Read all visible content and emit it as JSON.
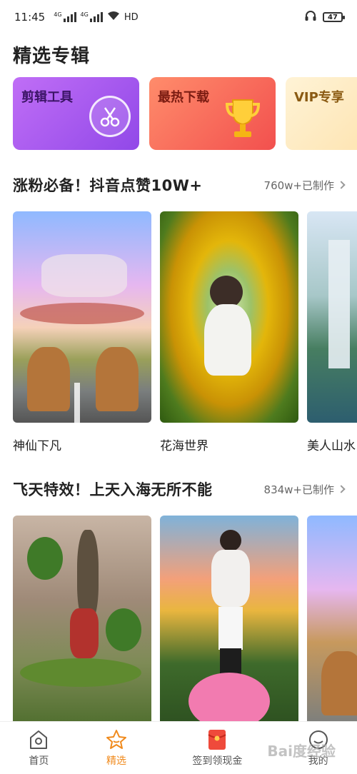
{
  "status_bar": {
    "time": "11:45",
    "network_a": "4G",
    "network_b": "4G",
    "hd": "HD",
    "battery": "47"
  },
  "page": {
    "title": "精选专辑"
  },
  "albums": [
    {
      "label": "剪辑工具",
      "icon": "scissors-icon"
    },
    {
      "label": "最热下载",
      "icon": "trophy-icon"
    },
    {
      "label": "VIP专享",
      "icon": "sparkle-icon"
    }
  ],
  "sections": [
    {
      "title": "涨粉必备！抖音点赞10W+",
      "more": "760w+已制作",
      "videos": [
        {
          "title": "神仙下凡"
        },
        {
          "title": "花海世界"
        },
        {
          "title": "美人山水"
        }
      ]
    },
    {
      "title": "飞天特效！上天入海无所不能",
      "more": "834w+已制作",
      "videos": [
        {
          "title": ""
        },
        {
          "title": ""
        },
        {
          "title": ""
        }
      ]
    }
  ],
  "tabbar": {
    "items": [
      {
        "label": "首页",
        "icon": "home-icon"
      },
      {
        "label": "精选",
        "icon": "star-icon"
      },
      {
        "label": "签到领现金",
        "icon": "red-envelope-icon"
      },
      {
        "label": "我的",
        "icon": "profile-icon"
      }
    ],
    "active_color": "#f08a1c"
  },
  "watermark": "Bai度经验"
}
